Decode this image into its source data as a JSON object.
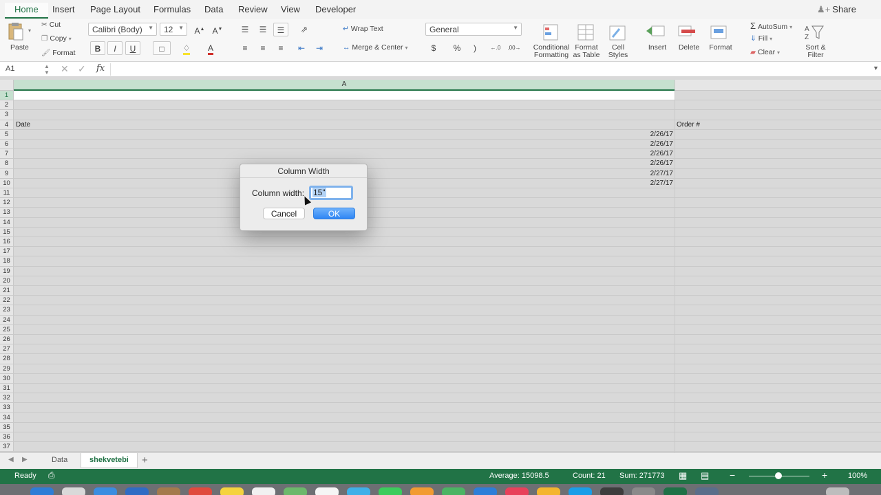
{
  "ribbon_tabs": [
    "Home",
    "Insert",
    "Page Layout",
    "Formulas",
    "Data",
    "Review",
    "View",
    "Developer"
  ],
  "share_label": "Share",
  "clipboard": {
    "paste": "Paste",
    "cut": "Cut",
    "copy": "Copy",
    "format": "Format"
  },
  "font": {
    "name": "Calibri (Body)",
    "size": "12"
  },
  "alignment": {
    "wrap_text": "Wrap Text",
    "merge_center": "Merge & Center"
  },
  "number": {
    "format": "General",
    "currency": "$",
    "percent": "%",
    "comma": ")"
  },
  "styles": {
    "conditional": "Conditional\nFormatting",
    "format_table": "Format\nas Table",
    "cell_styles": "Cell\nStyles"
  },
  "cells": {
    "insert": "Insert",
    "delete": "Delete",
    "format": "Format"
  },
  "editing": {
    "autosum": "AutoSum",
    "fill": "Fill",
    "clear": "Clear",
    "sort_filter": "Sort &\nFilter"
  },
  "formula_bar": {
    "name_box": "A1",
    "fx": "fx",
    "value": ""
  },
  "columns": {
    "a": "A"
  },
  "row_numbers": [
    "1",
    "2",
    "3",
    "4",
    "5",
    "6",
    "7",
    "8",
    "9",
    "10",
    "11",
    "12",
    "13",
    "14",
    "15",
    "16",
    "17",
    "18",
    "19",
    "20",
    "21",
    "22",
    "23",
    "24",
    "25",
    "26",
    "27",
    "28",
    "29",
    "30",
    "31",
    "32",
    "33",
    "34",
    "35",
    "36",
    "37"
  ],
  "cells_data": {
    "a4": "Date",
    "b4": "Order #",
    "a5": "2/26/17",
    "a6": "2/26/17",
    "a7": "2/26/17",
    "a8": "2/26/17",
    "a9": "2/27/17",
    "a10": "2/27/17"
  },
  "sheet_tabs": {
    "data": "Data",
    "active": "shekvetebi",
    "add": "+"
  },
  "status": {
    "ready": "Ready",
    "average": "Average: 15098.5",
    "count": "Count: 21",
    "sum": "Sum: 271773",
    "zoom": "100%"
  },
  "dialog": {
    "title": "Column Width",
    "label": "Column width:",
    "value": "15\"",
    "cancel": "Cancel",
    "ok": "OK"
  }
}
